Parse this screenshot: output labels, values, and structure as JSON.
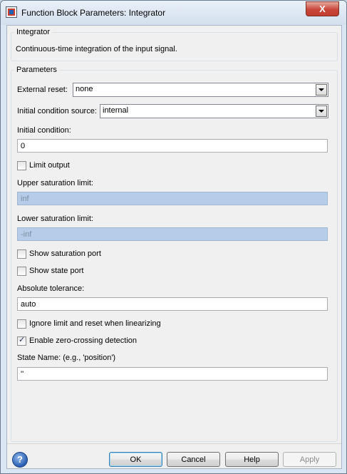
{
  "window": {
    "title": "Function Block Parameters: Integrator",
    "close_glyph": "X"
  },
  "block": {
    "group_label": "Integrator",
    "description": "Continuous-time integration of the input signal."
  },
  "parameters": {
    "group_label": "Parameters",
    "external_reset": {
      "label": "External reset:",
      "value": "none"
    },
    "initial_condition_source": {
      "label": "Initial condition source:",
      "value": "internal"
    },
    "initial_condition": {
      "label": "Initial condition:",
      "value": "0"
    },
    "limit_output": {
      "label": "Limit output",
      "checked": false
    },
    "upper_saturation": {
      "label": "Upper saturation limit:",
      "value": "inf"
    },
    "lower_saturation": {
      "label": "Lower saturation limit:",
      "value": "-inf"
    },
    "show_saturation_port": {
      "label": "Show saturation port",
      "checked": false
    },
    "show_state_port": {
      "label": "Show state port",
      "checked": false
    },
    "absolute_tolerance": {
      "label": "Absolute tolerance:",
      "value": "auto"
    },
    "ignore_limit": {
      "label": "Ignore limit and reset when linearizing",
      "checked": false
    },
    "zero_crossing": {
      "label": "Enable zero-crossing detection",
      "checked": true
    },
    "state_name": {
      "label": "State Name: (e.g., 'position')",
      "value": "''"
    }
  },
  "buttons": {
    "ok": "OK",
    "cancel": "Cancel",
    "help": "Help",
    "apply": "Apply"
  },
  "help_icon_glyph": "?"
}
